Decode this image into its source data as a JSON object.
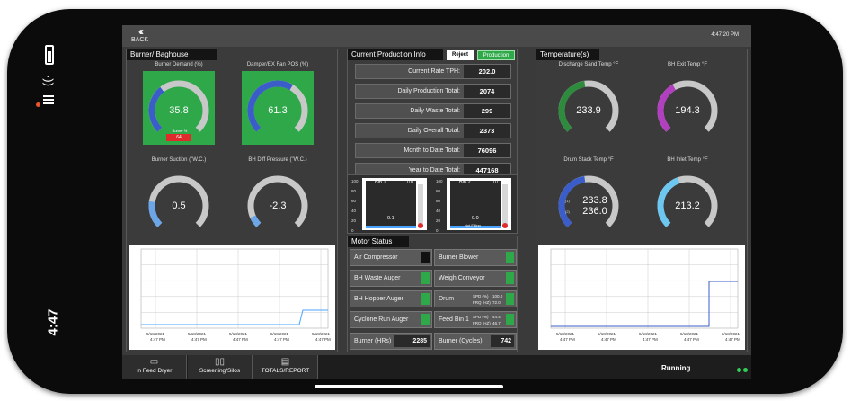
{
  "device": {
    "time": "4:47"
  },
  "topbar": {
    "back_label": "BACK",
    "clock": "4:47:20 PM"
  },
  "burner_panel": {
    "title": "Burner/ Baghouse",
    "gauges": [
      {
        "title": "Burner Demand (%)",
        "value": "35.8",
        "level": 0.358,
        "badge_text": "Burner % ",
        "badge_value": "64",
        "color": "#3b5dc9"
      },
      {
        "title": "Damper/EX Fan POS (%)",
        "value": "61.3",
        "level": 0.613,
        "color": "#3b5dc9"
      },
      {
        "title": "Burner Suction (\"W.C.)",
        "value": "0.5",
        "level": 0.2,
        "color": "#6aa6e8"
      },
      {
        "title": "BH Diff Pressure (\"W.C.)",
        "value": "-2.3",
        "level": 0.08,
        "color": "#6aa6e8"
      }
    ],
    "trend_x_labels": [
      "5/18/2021\n4:47 PM",
      "5/18/2021\n4:47 PM",
      "5/18/2021\n4:47 PM",
      "5/18/2021\n4:47 PM",
      "5/18/2021\n4:47 PM"
    ]
  },
  "production_panel": {
    "title": "Current Production Info",
    "reject_label": "Reject",
    "production_label": "Production",
    "rows": [
      {
        "label": "Current Rate TPH:",
        "value": "202.0"
      },
      {
        "label": "Daily Production Total:",
        "value": "2074"
      },
      {
        "label": "Daily Waste Total:",
        "value": "299"
      },
      {
        "label": "Daily Overall Total:",
        "value": "2373"
      },
      {
        "label": "Month to Date Total:",
        "value": "76096"
      },
      {
        "label": "Year to Date Total:",
        "value": "447168"
      }
    ],
    "bins": [
      {
        "name": "Bin 1",
        "top_value": "0.0",
        "mid_value": "0.1",
        "status": ""
      },
      {
        "name": "Bin 2",
        "top_value": "0.0",
        "mid_value": "0.0",
        "status": "Not Filling"
      }
    ],
    "bin_scale": [
      "100",
      "80",
      "60",
      "40",
      "20",
      "0"
    ]
  },
  "motor_panel": {
    "title": "Motor Status",
    "left": [
      {
        "label": "Air Compressor",
        "state": "off"
      },
      {
        "label": "BH Waste Auger",
        "state": "on"
      },
      {
        "label": "BH Hopper Auger",
        "state": "on"
      },
      {
        "label": "Cyclone Run Auger",
        "state": "on"
      }
    ],
    "right": [
      {
        "label": "Burner Blower",
        "state": "on"
      },
      {
        "label": "Weigh Conveyor",
        "state": "on"
      },
      {
        "label": "Drum",
        "state": "on",
        "spd_label": "SPD (%)",
        "spd_value": "100.0",
        "frq_label": "FRQ (HZ)",
        "frq_value": "72.0"
      },
      {
        "label": "Feed Bin 1",
        "state": "on",
        "spd_label": "SPD (%)",
        "spd_value": "44.4",
        "frq_label": "FRQ (HZ)",
        "frq_value": "46.7"
      }
    ],
    "burner_hrs_label": "Burner (HRs)",
    "burner_hrs_value": "2285",
    "burner_cycles_label": "Burner (Cycles)",
    "burner_cycles_value": "742"
  },
  "temp_panel": {
    "title": "Temperature(s)",
    "gauges": [
      {
        "title": "Discharge Sand Temp °F",
        "value": "233.9",
        "level": 0.47,
        "color": "#2e8b3e"
      },
      {
        "title": "BH Exit Temp °F",
        "value": "194.3",
        "level": 0.39,
        "color": "#b23fc0"
      },
      {
        "title": "Drum Stack Temp °F",
        "value": "233.8",
        "value2": "236.0",
        "tag1": "(1)",
        "tag2": "(2)",
        "level": 0.47,
        "color": "#3b5dc9"
      },
      {
        "title": "BH Inlet Temp °F",
        "value": "213.2",
        "level": 0.43,
        "color": "#6cc8f0"
      }
    ]
  },
  "bottom_nav": {
    "items": [
      {
        "label": "In Feed Dryer",
        "icon": "dryer-icon"
      },
      {
        "label": "Screening/Silos",
        "icon": "silos-icon"
      },
      {
        "label": "TOTALS/REPORT",
        "icon": "report-icon"
      }
    ],
    "status": "Running"
  },
  "colors": {
    "on": "#2fa84a",
    "off": "#111111",
    "reject": "#ffffff",
    "production": "#2fa84a",
    "badge": "#e02b2b"
  }
}
